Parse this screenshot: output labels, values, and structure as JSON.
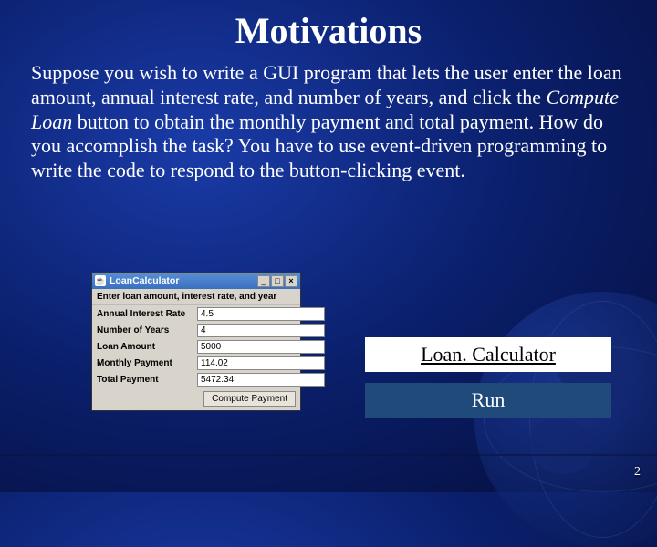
{
  "title": "Motivations",
  "body": {
    "part1": "Suppose you wish to write a GUI program that lets the user enter the loan amount, annual interest rate, and number of years, and click the ",
    "italic": "Compute Loan",
    "part2": " button to obtain the monthly payment and total payment. How do you accomplish the task? You have to use event-driven programming to write the code to respond to the button-clicking event."
  },
  "app": {
    "java_icon": "☕",
    "window_title": "LoanCalculator",
    "min": "_",
    "max": "□",
    "close": "×",
    "instruction": "Enter loan amount, interest rate, and year",
    "rows": [
      {
        "label": "Annual Interest Rate",
        "value": "4.5"
      },
      {
        "label": "Number of Years",
        "value": "4"
      },
      {
        "label": "Loan Amount",
        "value": "5000"
      },
      {
        "label": "Monthly Payment",
        "value": "114.02"
      },
      {
        "label": "Total Payment",
        "value": "5472.34"
      }
    ],
    "button": "Compute Payment"
  },
  "links": {
    "calc": "Loan. Calculator",
    "run": "Run"
  },
  "page": "2"
}
